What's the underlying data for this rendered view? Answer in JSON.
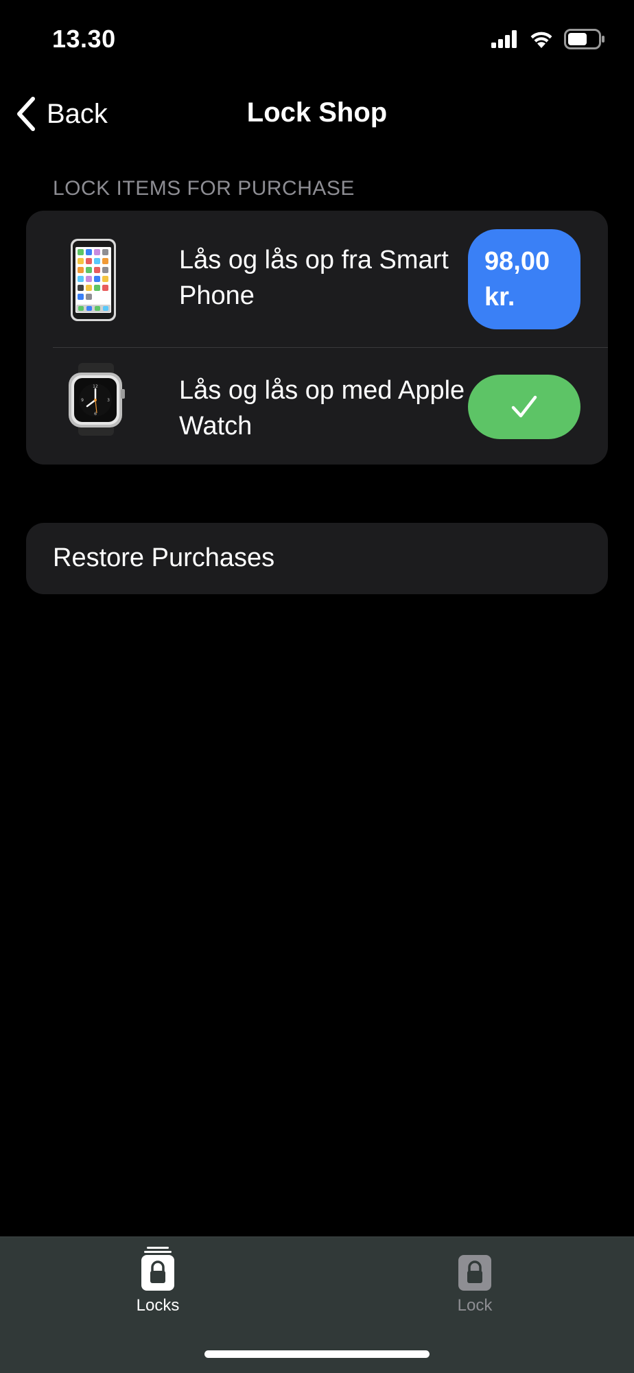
{
  "status_bar": {
    "time": "13.30"
  },
  "nav": {
    "back_label": "Back",
    "title": "Lock Shop"
  },
  "section": {
    "header": "LOCK ITEMS FOR PURCHASE"
  },
  "items": [
    {
      "icon": "smartphone-icon",
      "label": "Lås og lås op fra Smart Phone",
      "price": "98,00 kr.",
      "state": "for-sale"
    },
    {
      "icon": "apple-watch-icon",
      "label": "Lås og lås op med Apple Watch",
      "state": "purchased",
      "status_icon": "checkmark-icon"
    }
  ],
  "restore": {
    "label": "Restore Purchases"
  },
  "tab_bar": {
    "tabs": [
      {
        "label": "Locks",
        "icon": "locks-stack-icon",
        "active": true
      },
      {
        "label": "Lock",
        "icon": "lock-icon",
        "active": false
      }
    ]
  },
  "colors": {
    "background": "#000000",
    "card": "#1c1c1e",
    "price_button": "#3a80f6",
    "owned_button": "#5dc466",
    "section_header": "#8d8d93",
    "tab_bar": "#313938",
    "tab_inactive": "#8e8e93"
  }
}
